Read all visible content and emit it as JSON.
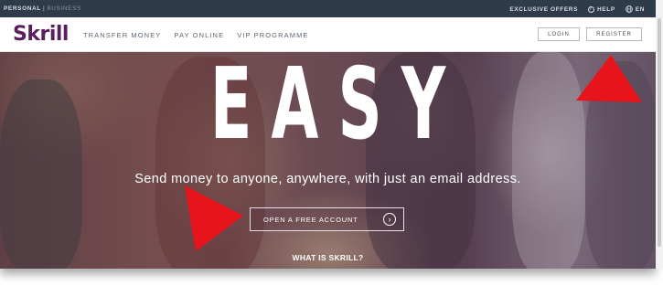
{
  "topbar": {
    "personal": "PERSONAL",
    "separator": "|",
    "business": "BUSINESS",
    "exclusive_offers": "EXCLUSIVE OFFERS",
    "help": "HELP",
    "language": "EN"
  },
  "nav": {
    "logo": "Skrill",
    "links": [
      "TRANSFER MONEY",
      "PAY ONLINE",
      "VIP PROGRAMME"
    ],
    "login": "LOGIN",
    "register": "REGISTER"
  },
  "hero": {
    "title": "EASY",
    "subtitle": "Send money to anyone, anywhere, with just an email address.",
    "cta": "OPEN A FREE ACCOUNT",
    "what_is": "WHAT IS SKRILL?"
  },
  "colors": {
    "brand": "#5a1e5f",
    "topbar": "#2f3b4a",
    "arrow": "#e8141b"
  },
  "icons": [
    "help-icon",
    "globe-icon",
    "chevron-right-icon",
    "arrow-annotation"
  ]
}
